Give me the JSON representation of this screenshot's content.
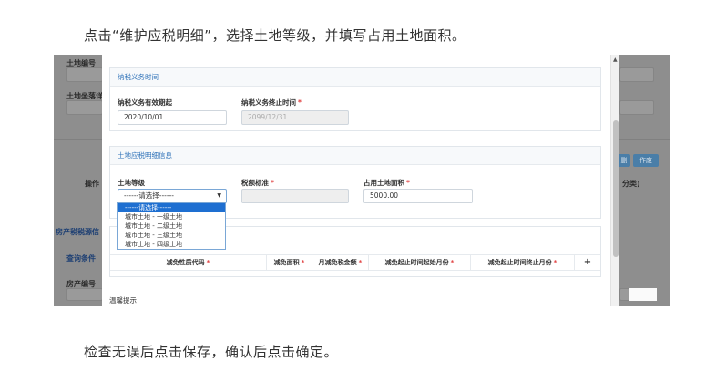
{
  "captions": {
    "top": "点击“维护应税明细”，选择土地等级，并填写占用土地面积。",
    "bottom": "检查无误后点击保存，确认后点击确定。"
  },
  "background": {
    "land_no_label": "土地编号",
    "land_cert_label": "土地坐落详细",
    "operation_col": "操作",
    "house_tax_label": "房产税税源信",
    "query_cond_label": "查询条件",
    "house_no_label": "房产编号",
    "btn_a": "删",
    "btn_b": "作废",
    "right_col": "分类)"
  },
  "modal": {
    "section1": {
      "title": "纳税义务时间",
      "start_label": "纳税义务有效期起",
      "start_value": "2020/10/01",
      "end_label": "纳税义务终止时间",
      "end_required": "*",
      "end_value": "2099/12/31"
    },
    "section2": {
      "title": "土地应税明细信息",
      "grade_label": "土地等级",
      "grade_value": "------请选择------",
      "tax_std_label": "税额标准",
      "tax_std_required": "*",
      "area_label": "占用土地面积",
      "area_required": "*",
      "area_value": "5000.00",
      "options": [
        "------请选择------",
        "城市土地 - 一级土地",
        "城市土地 - 二级土地",
        "城市土地 - 三级土地",
        "城市土地 - 四级土地"
      ]
    },
    "section3": {
      "columns": [
        {
          "label": "减免性质代码",
          "req": "*"
        },
        {
          "label": "减免面积",
          "req": "*"
        },
        {
          "label": "月减免税金额",
          "req": "*"
        },
        {
          "label": "减免起止时间起始月份",
          "req": "*"
        },
        {
          "label": "减免起止时间终止月份",
          "req": "*"
        }
      ],
      "add_label": "+"
    },
    "tip": "温馨提示"
  },
  "colors": {
    "accent": "#2d71b8",
    "required": "#e03b3b",
    "selected_option": "#1e6fd1"
  }
}
